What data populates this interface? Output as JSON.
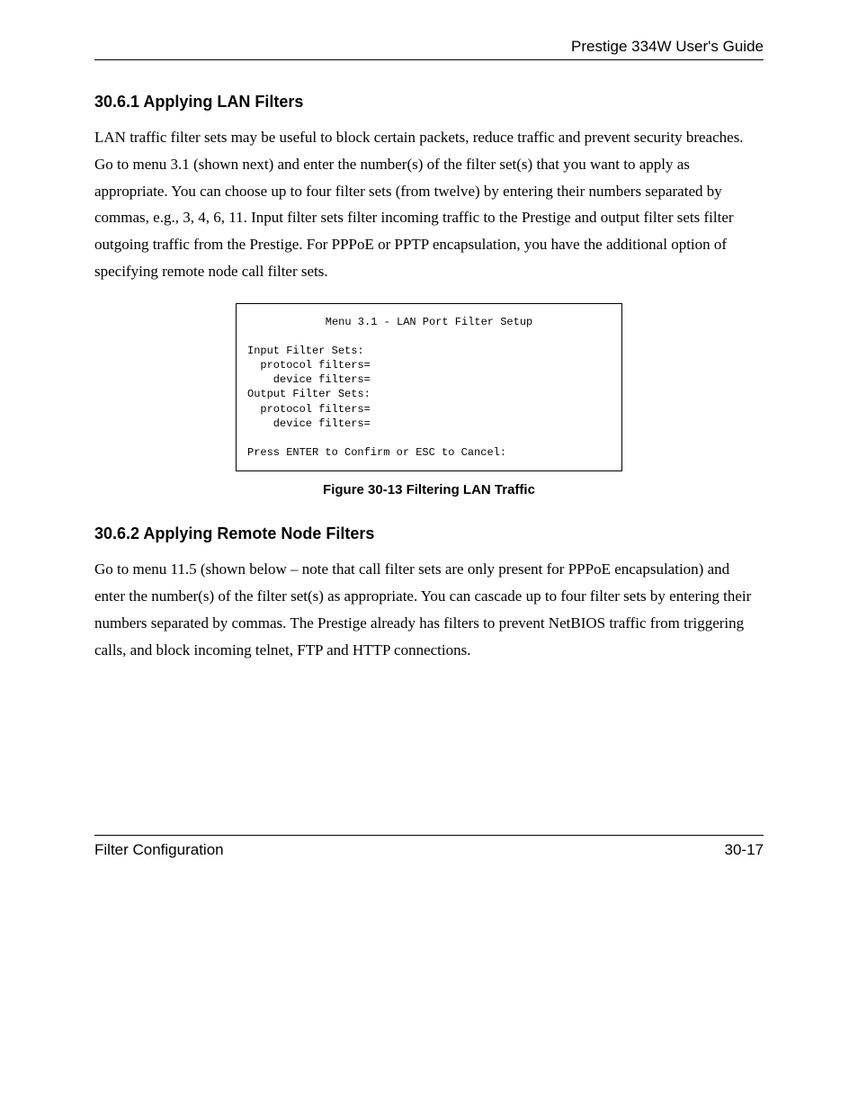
{
  "header": {
    "guide_title": "Prestige 334W User's Guide"
  },
  "sections": {
    "s1": {
      "heading": "30.6.1 Applying LAN Filters",
      "body": "LAN traffic filter sets may be useful to block certain packets, reduce traffic and prevent security breaches. Go to menu 3.1 (shown next) and enter the number(s) of the filter set(s) that you want to apply as appropriate. You can choose up to four filter sets (from twelve) by entering their numbers separated by commas, e.g., 3, 4, 6, 11. Input filter sets filter incoming traffic to the Prestige and output filter sets filter outgoing traffic from the Prestige. For PPPoE or PPTP encapsulation, you have the additional option of specifying remote node call filter sets."
    },
    "menu_box": {
      "title": "Menu 3.1 - LAN Port Filter Setup",
      "line1": "Input Filter Sets:",
      "line2": "  protocol filters=",
      "line3": "    device filters=",
      "line4": "Output Filter Sets:",
      "line5": "  protocol filters=",
      "line6": "    device filters=",
      "line7": "Press ENTER to Confirm or ESC to Cancel:"
    },
    "figure_caption": "Figure 30-13 Filtering LAN Traffic",
    "s2": {
      "heading": "30.6.2 Applying Remote Node Filters",
      "body": "Go to menu 11.5 (shown below – note that call filter sets are only present for PPPoE encapsulation) and enter the number(s) of the filter set(s) as appropriate. You can cascade up to four filter sets by entering their numbers separated by commas. The Prestige already has filters to prevent NetBIOS traffic from triggering calls, and block incoming telnet, FTP and HTTP connections."
    }
  },
  "footer": {
    "left": "Filter Configuration",
    "right": "30-17"
  }
}
